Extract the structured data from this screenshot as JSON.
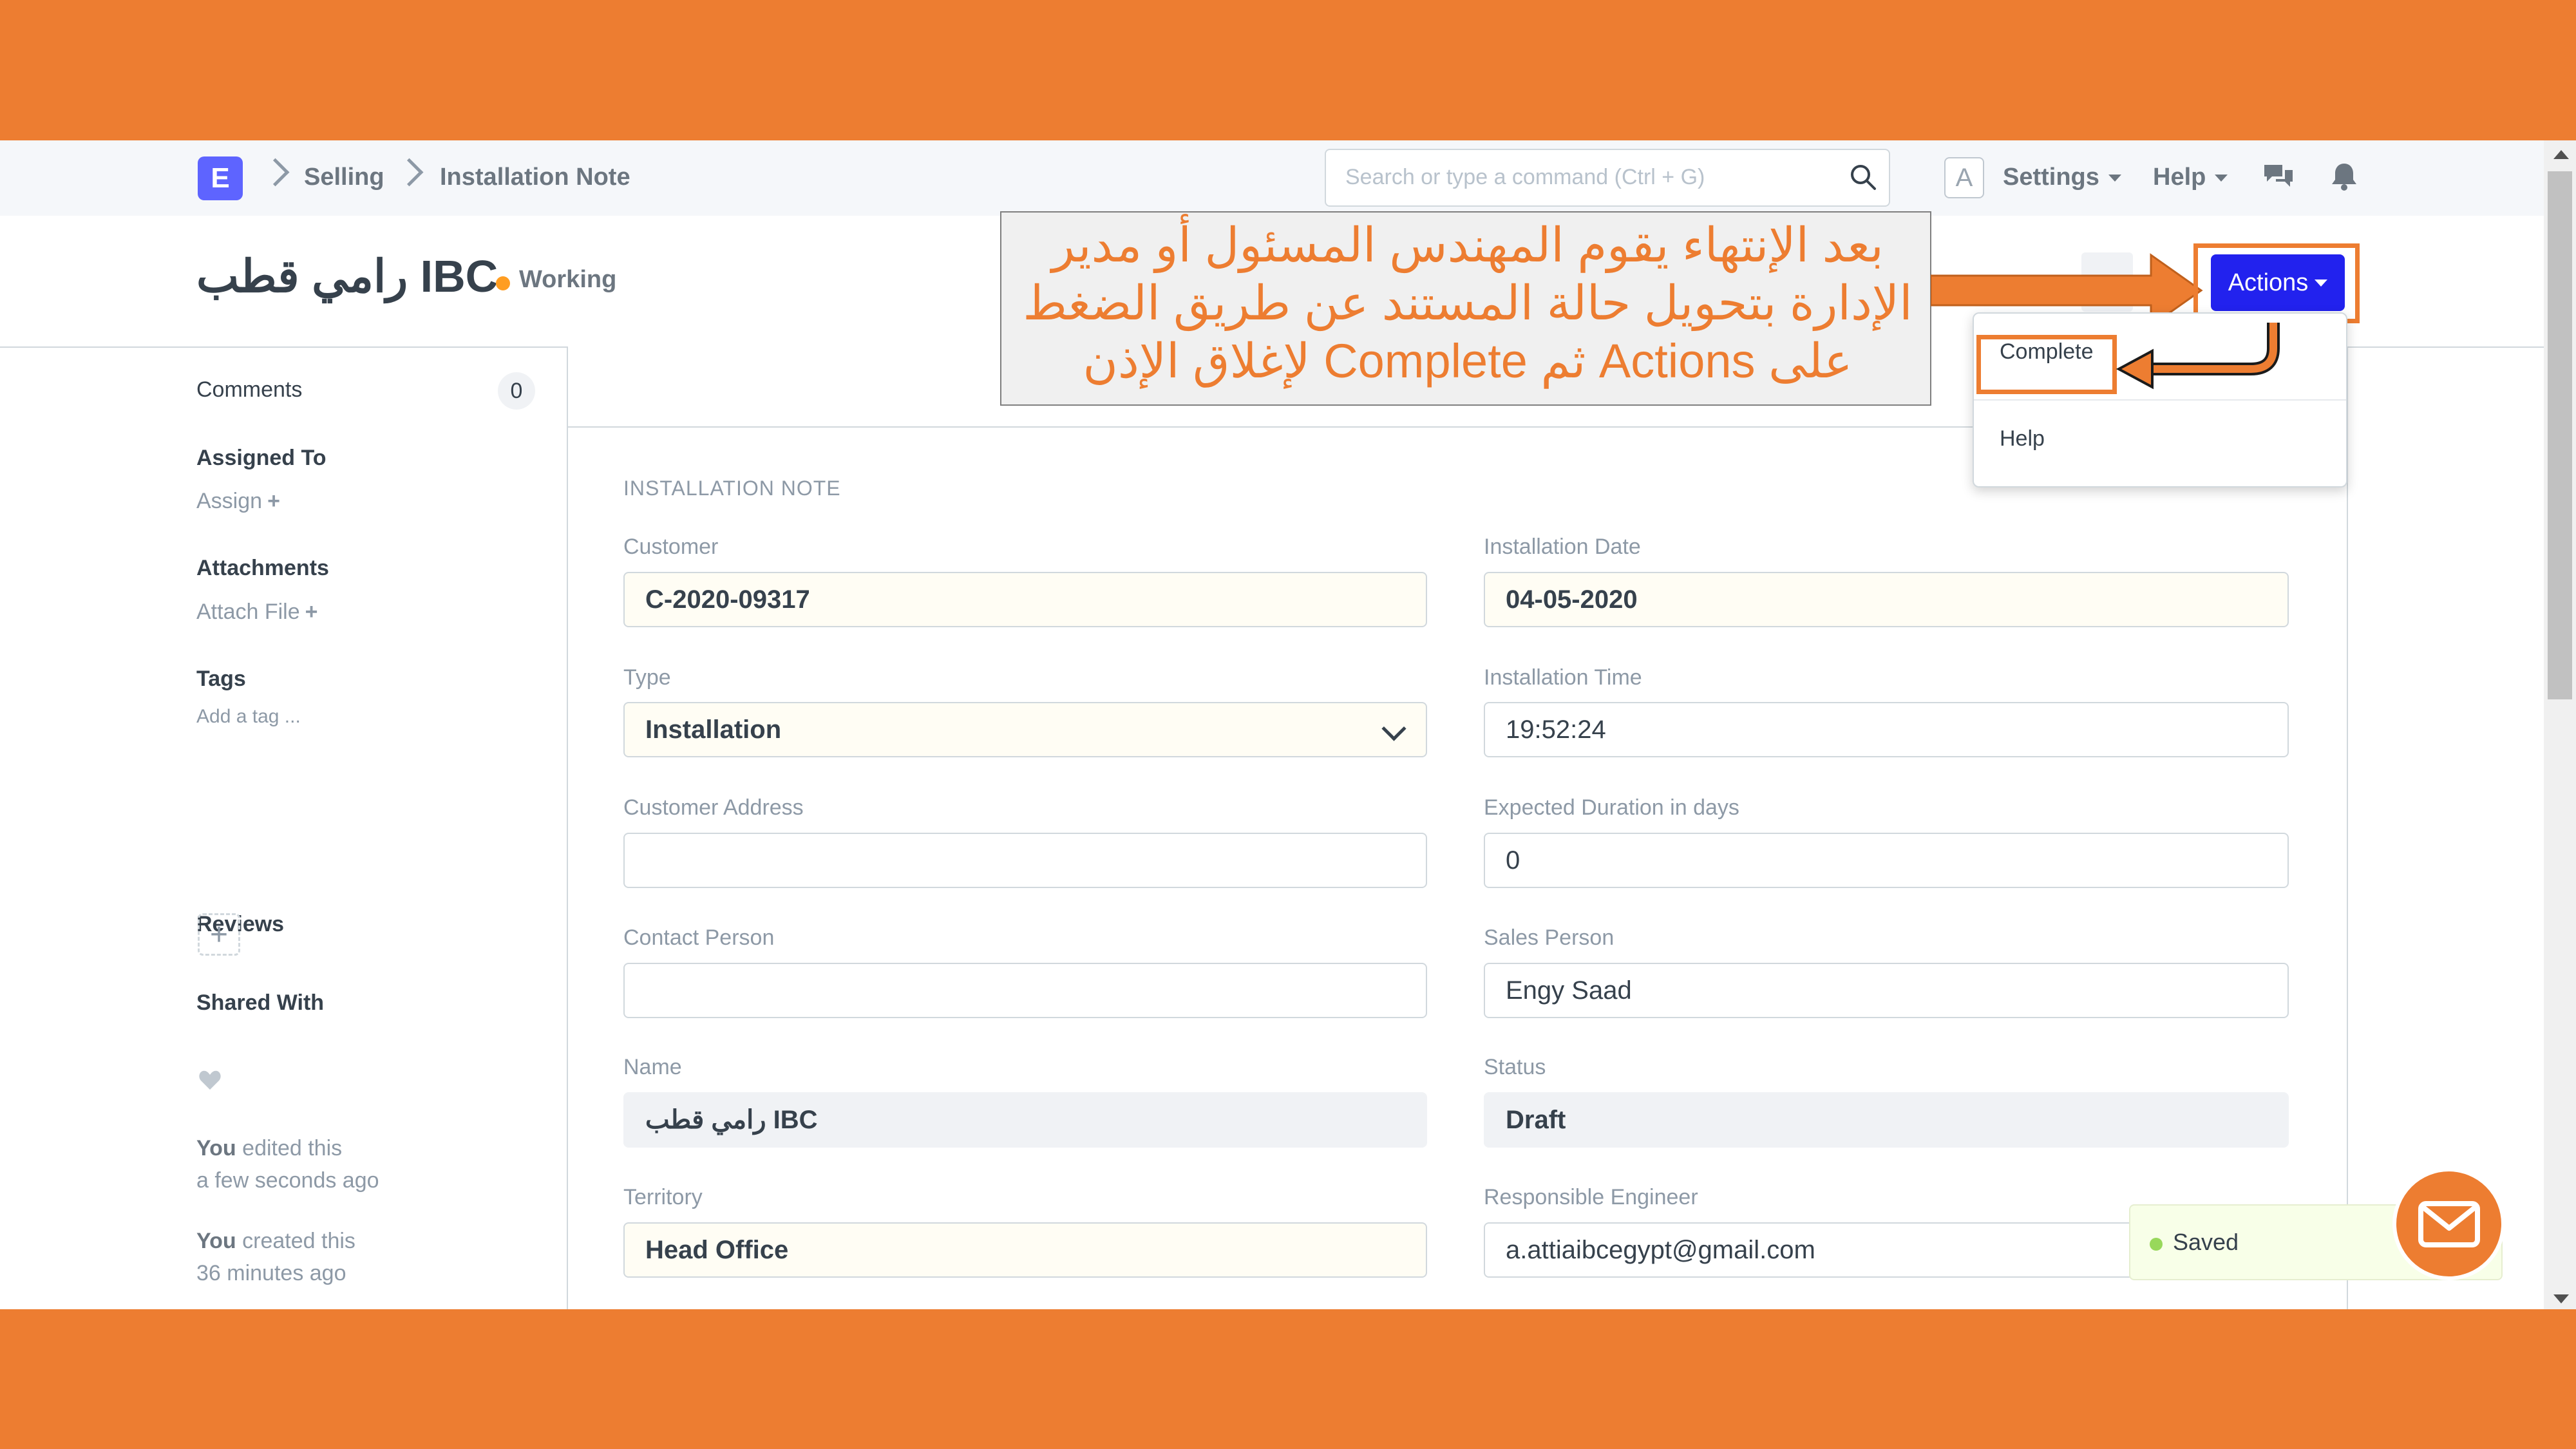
{
  "navbar": {
    "logo": "E",
    "breadcrumbs": [
      "Selling",
      "Installation Note"
    ],
    "search_placeholder": "Search or type a command (Ctrl + G)",
    "avatar": "A",
    "settings": "Settings",
    "help": "Help"
  },
  "page": {
    "title": "رامي قطب IBC",
    "status": "Working"
  },
  "actions": {
    "button": "Actions",
    "menu": [
      "Complete",
      "Help"
    ]
  },
  "annotation": {
    "lines": [
      "بعد الإنتهاء يقوم المهندس المسئول أو مدير",
      "الإدارة بتحويل حالة المستند عن طريق الضغط",
      "على Actions ثم Complete لإغلاق الإذن"
    ]
  },
  "sidebar": {
    "comments_label": "Comments",
    "comments_count": "0",
    "assigned_to": "Assigned To",
    "assign": "Assign",
    "attachments": "Attachments",
    "attach_file": "Attach File",
    "tags": "Tags",
    "add_tag": "Add a tag ...",
    "reviews": "Reviews",
    "shared_with": "Shared With",
    "timeline": [
      {
        "who": "You",
        "action": "edited this",
        "when": "a few seconds ago"
      },
      {
        "who": "You",
        "action": "created this",
        "when": "36 minutes ago"
      }
    ]
  },
  "form": {
    "section": "INSTALLATION NOTE",
    "customer": {
      "label": "Customer",
      "value": "C-2020-09317"
    },
    "installation_date": {
      "label": "Installation Date",
      "value": "04-05-2020"
    },
    "type": {
      "label": "Type",
      "value": "Installation"
    },
    "installation_time": {
      "label": "Installation Time",
      "value": "19:52:24"
    },
    "customer_address": {
      "label": "Customer Address",
      "value": ""
    },
    "expected_duration": {
      "label": "Expected Duration in days",
      "value": "0"
    },
    "contact_person": {
      "label": "Contact Person",
      "value": ""
    },
    "sales_person": {
      "label": "Sales Person",
      "value": "Engy Saad"
    },
    "name": {
      "label": "Name",
      "value": "رامي قطب IBC"
    },
    "status": {
      "label": "Status",
      "value": "Draft"
    },
    "territory": {
      "label": "Territory",
      "value": "Head Office"
    },
    "responsible_engineer": {
      "label": "Responsible Engineer",
      "value": "a.attiaibcegypt@gmail.com"
    }
  },
  "toast": {
    "text": "Saved"
  },
  "colors": {
    "accent": "#ED7D31",
    "primary": "#2222EE",
    "status_working": "#FF9D21"
  }
}
